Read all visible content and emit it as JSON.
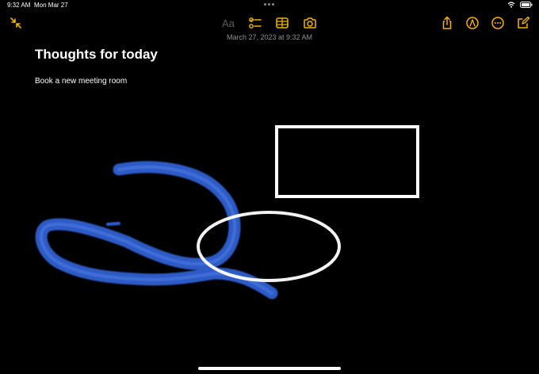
{
  "status_bar": {
    "time": "9:32 AM",
    "date": "Mon Mar 27"
  },
  "toolbar": {
    "left": [
      {
        "name": "collapse-icon"
      }
    ],
    "center": [
      {
        "name": "text-format-icon",
        "label": "Aa"
      },
      {
        "name": "checklist-icon"
      },
      {
        "name": "table-icon"
      },
      {
        "name": "camera-icon"
      }
    ],
    "right": [
      {
        "name": "share-icon"
      },
      {
        "name": "markup-pen-icon"
      },
      {
        "name": "more-icon"
      },
      {
        "name": "compose-icon"
      }
    ]
  },
  "note": {
    "timestamp": "March 27, 2023 at 9:32 AM",
    "title": "Thoughts for today",
    "body": "Book a new meeting room"
  },
  "drawing": {
    "strokes": [
      "blue-marker-scribble",
      "white-rectangle",
      "white-ellipse"
    ]
  },
  "colors": {
    "background": "#000000",
    "accent": "#f4b400",
    "ink_blue": "#2f5fd0",
    "ink_white": "#ffffff"
  }
}
